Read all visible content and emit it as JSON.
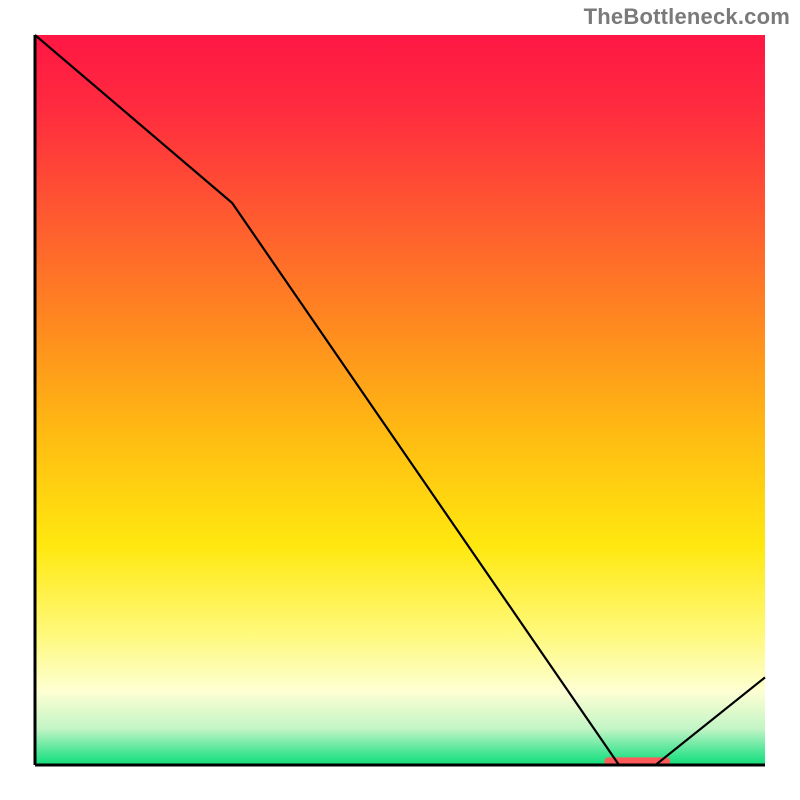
{
  "attribution": "TheBottleneck.com",
  "chart_data": {
    "type": "line",
    "title": "",
    "xlabel": "",
    "ylabel": "",
    "x": [
      0,
      0.27,
      0.8,
      0.85,
      1.0
    ],
    "y": [
      100,
      77,
      0,
      0,
      12
    ],
    "ylim": [
      0,
      100
    ],
    "xlim": [
      0,
      1
    ],
    "background_gradient": {
      "stops": [
        {
          "offset": 0.0,
          "color": "#ff1744"
        },
        {
          "offset": 0.1,
          "color": "#ff2b3f"
        },
        {
          "offset": 0.25,
          "color": "#ff5a30"
        },
        {
          "offset": 0.4,
          "color": "#ff8a1f"
        },
        {
          "offset": 0.55,
          "color": "#ffbc12"
        },
        {
          "offset": 0.7,
          "color": "#ffe80f"
        },
        {
          "offset": 0.82,
          "color": "#fff97a"
        },
        {
          "offset": 0.9,
          "color": "#fdffd3"
        },
        {
          "offset": 0.95,
          "color": "#c3f5c6"
        },
        {
          "offset": 0.99,
          "color": "#2fe28a"
        },
        {
          "offset": 1.0,
          "color": "#16dd7b"
        }
      ]
    },
    "marker": {
      "x_start": 0.78,
      "x_end": 0.87,
      "y": 0.5,
      "color": "#ff5a5a"
    },
    "axis_color": "#000000"
  }
}
